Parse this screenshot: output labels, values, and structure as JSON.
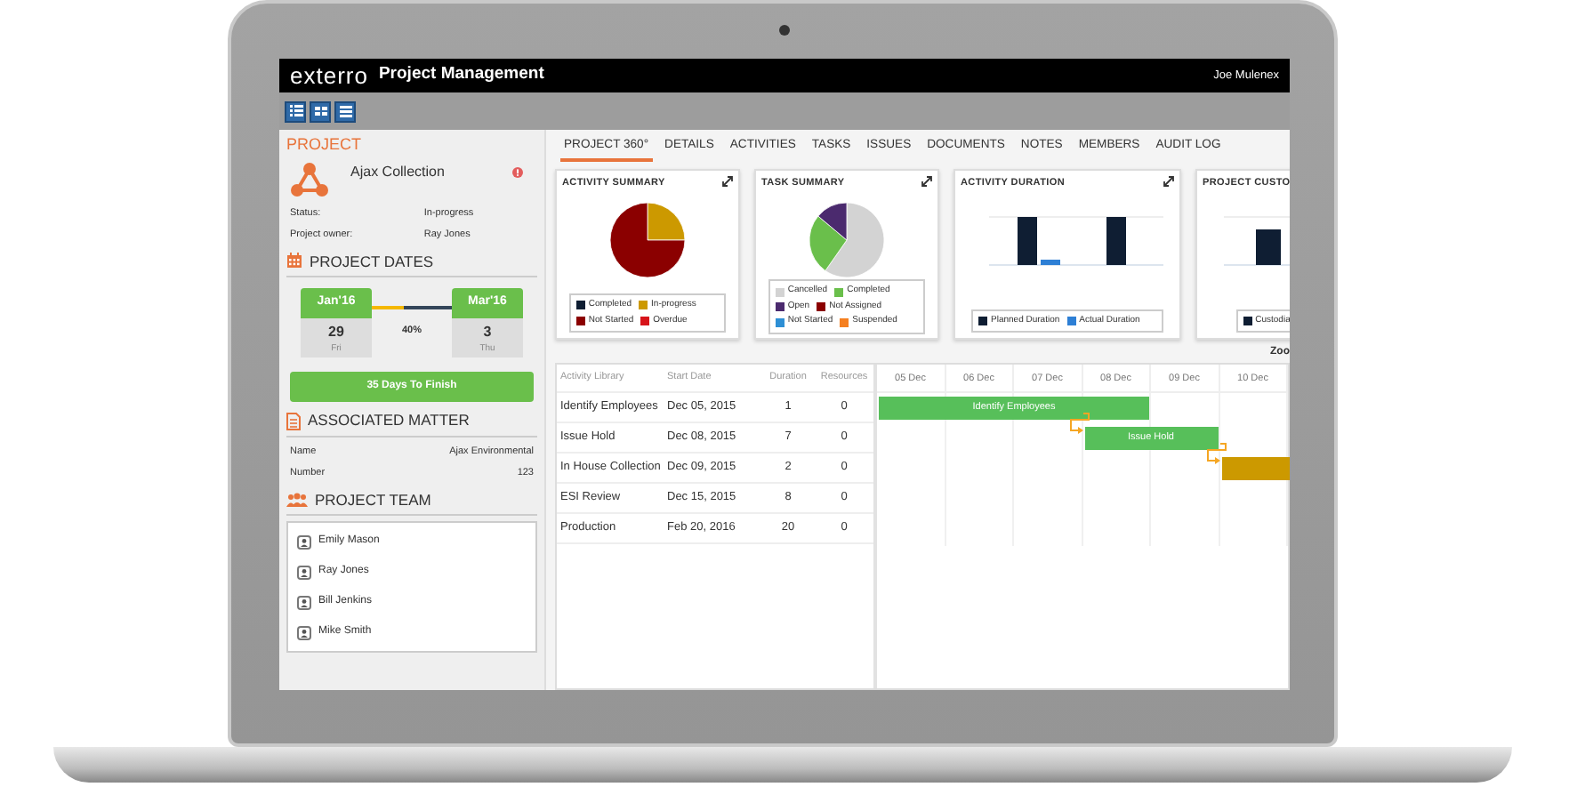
{
  "app": {
    "logo": "exterro",
    "title": "Project Management",
    "user": "Joe Mulenex"
  },
  "project": {
    "heading": "PROJECT",
    "name": "Ajax Collection",
    "fields": [
      {
        "label": "Status:",
        "value": "In-progress"
      },
      {
        "label": "Project owner:",
        "value": "Ray Jones"
      }
    ]
  },
  "project_dates": {
    "heading": "PROJECT DATES",
    "start": {
      "month": "Jan'16",
      "day": "29",
      "weekday": "Fri"
    },
    "end": {
      "month": "Mar'16",
      "day": "3",
      "weekday": "Thu"
    },
    "progress": "40%",
    "level": 0.4,
    "remaining": "35 Days To Finish"
  },
  "associated_matter": {
    "heading": "ASSOCIATED MATTER",
    "fields": [
      {
        "label": "Name",
        "value": "Ajax Environmental"
      },
      {
        "label": "Number",
        "value": "123"
      }
    ]
  },
  "project_team": {
    "heading": "PROJECT TEAM",
    "members": [
      "Emily Mason",
      "Ray Jones",
      "Bill Jenkins",
      "Mike Smith"
    ]
  },
  "tabs": [
    {
      "label": "PROJECT 360°",
      "selected": true
    },
    {
      "label": "DETAILS",
      "selected": false
    },
    {
      "label": "ACTIVITIES",
      "selected": false
    },
    {
      "label": "TASKS",
      "selected": false
    },
    {
      "label": "ISSUES",
      "selected": false
    },
    {
      "label": "DOCUMENTS",
      "selected": false
    },
    {
      "label": "NOTES",
      "selected": false
    },
    {
      "label": "MEMBERS",
      "selected": false
    },
    {
      "label": "AUDIT LOG",
      "selected": false
    }
  ],
  "cards": [
    {
      "title": "ACTIVITY SUMMARY",
      "kind": "pie",
      "legend": [
        {
          "label": "Completed",
          "color": "#0f1e33"
        },
        {
          "label": "In-progress",
          "color": "#cc9900"
        },
        {
          "label": "Not Started",
          "color": "#8b0000"
        },
        {
          "label": "Overdue",
          "color": "#d7141a"
        }
      ]
    },
    {
      "title": "TASK SUMMARY",
      "kind": "pie",
      "legend": [
        {
          "label": "Cancelled",
          "color": "#d3d3d3"
        },
        {
          "label": "Completed",
          "color": "#6abf4b"
        },
        {
          "label": "Open",
          "color": "#4b2a6e"
        },
        {
          "label": "Not Assigned",
          "color": "#8b0000"
        },
        {
          "label": "Not Started",
          "color": "#2d8fd5"
        },
        {
          "label": "Suspended",
          "color": "#f57f20"
        }
      ]
    },
    {
      "title": "ACTIVITY DURATION",
      "kind": "bar",
      "legend": [
        {
          "label": "Planned Duration",
          "color": "#0f1e33"
        },
        {
          "label": "Actual Duration",
          "color": "#2d7fd5"
        }
      ]
    },
    {
      "title": "PROJECT CUSTO",
      "kind": "bar",
      "legend": [
        {
          "label": "Custodia",
          "color": "#0f1e33"
        }
      ]
    }
  ],
  "gantt": {
    "zoom_label": "Zoo",
    "columns": [
      "Activity Library",
      "Start Date",
      "Duration",
      "Resources"
    ],
    "rows": [
      {
        "activity": "Identify Employees",
        "start": "Dec 05, 2015",
        "duration": "1",
        "resources": "0"
      },
      {
        "activity": "Issue Hold",
        "start": "Dec 08, 2015",
        "duration": "7",
        "resources": "0"
      },
      {
        "activity": "In House Collection",
        "start": "Dec 09, 2015",
        "duration": "2",
        "resources": "0"
      },
      {
        "activity": "ESI Review",
        "start": "Dec 15, 2015",
        "duration": "8",
        "resources": "0"
      },
      {
        "activity": "Production",
        "start": "Feb 20, 2016",
        "duration": "20",
        "resources": "0"
      }
    ],
    "days": [
      "05 Dec",
      "06 Dec",
      "07 Dec",
      "08 Dec",
      "09 Dec",
      "10 Dec"
    ],
    "bars": [
      {
        "label": "Identify Employees",
        "color": "#57bf5a"
      },
      {
        "label": "Issue Hold",
        "color": "#57bf5a"
      },
      {
        "color": "#cc9900"
      }
    ]
  }
}
